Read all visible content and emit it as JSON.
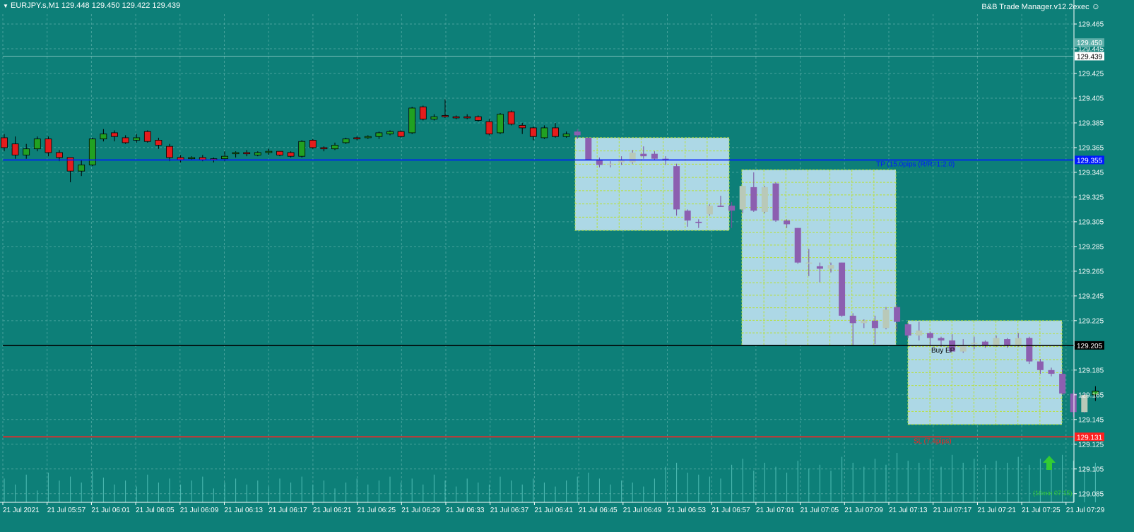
{
  "header": {
    "symbol_info": "EURJPY.s,M1  129.448 129.450 129.422 129.439",
    "ea_name": "B&B Trade Manager.v12.2exec"
  },
  "colors": {
    "background": "#0d7f78",
    "bull_candle": "#21a121",
    "bear_candle": "#e51c1c",
    "box_candle_bear": "#8c5fb0",
    "box_candle_bull": "#b9c9b8",
    "box_fill": "#add8e6",
    "box_grid": "#b8e03a",
    "tp_line": "#0019ff",
    "ep_line": "#000000",
    "sl_line": "#ff2020"
  },
  "chart_data": {
    "type": "candlestick",
    "symbol": "EURJPY.s",
    "timeframe": "M1",
    "y_axis": {
      "ylim": [
        129.078,
        129.473
      ],
      "ticks": [
        "129.465",
        "129.445",
        "129.425",
        "129.405",
        "129.385",
        "129.365",
        "129.345",
        "129.325",
        "129.305",
        "129.285",
        "129.265",
        "129.245",
        "129.225",
        "129.205",
        "129.185",
        "129.165",
        "129.145",
        "129.125",
        "129.105",
        "129.085"
      ]
    },
    "x_axis": {
      "ticks": [
        "21 Jul 2021",
        "21 Jul 05:57",
        "21 Jul 06:01",
        "21 Jul 06:05",
        "21 Jul 06:09",
        "21 Jul 06:13",
        "21 Jul 06:17",
        "21 Jul 06:21",
        "21 Jul 06:25",
        "21 Jul 06:29",
        "21 Jul 06:33",
        "21 Jul 06:37",
        "21 Jul 06:41",
        "21 Jul 06:45",
        "21 Jul 06:49",
        "21 Jul 06:53",
        "21 Jul 06:57",
        "21 Jul 07:01",
        "21 Jul 07:05",
        "21 Jul 07:09",
        "21 Jul 07:13",
        "21 Jul 07:17",
        "21 Jul 07:21",
        "21 Jul 07:25",
        "21 Jul 07:29"
      ]
    },
    "candles": [
      [
        129.373,
        129.376,
        129.362,
        129.365
      ],
      [
        129.368,
        129.374,
        129.356,
        129.359
      ],
      [
        129.359,
        129.368,
        129.356,
        129.364
      ],
      [
        129.364,
        129.374,
        129.362,
        129.372
      ],
      [
        129.372,
        129.374,
        129.358,
        129.361
      ],
      [
        129.361,
        129.363,
        129.354,
        129.357
      ],
      [
        129.357,
        129.357,
        129.337,
        129.346
      ],
      [
        129.346,
        129.355,
        129.342,
        129.351
      ],
      [
        129.351,
        129.373,
        129.35,
        129.372
      ],
      [
        129.372,
        129.38,
        129.37,
        129.376
      ],
      [
        129.377,
        129.379,
        129.37,
        129.374
      ],
      [
        129.373,
        129.375,
        129.368,
        129.369
      ],
      [
        129.371,
        129.376,
        129.369,
        129.373
      ],
      [
        129.378,
        129.379,
        129.369,
        129.37
      ],
      [
        129.371,
        129.373,
        129.364,
        129.367
      ],
      [
        129.366,
        129.368,
        129.354,
        129.357
      ],
      [
        129.357,
        129.359,
        129.353,
        129.355
      ],
      [
        129.356,
        129.358,
        129.355,
        129.357
      ],
      [
        129.357,
        129.359,
        129.354,
        129.355
      ],
      [
        129.356,
        129.357,
        129.353,
        129.355
      ],
      [
        129.356,
        129.362,
        129.354,
        129.358
      ],
      [
        129.36,
        129.362,
        129.357,
        129.361
      ],
      [
        129.361,
        129.363,
        129.358,
        129.36
      ],
      [
        129.359,
        129.362,
        129.358,
        129.361
      ],
      [
        129.361,
        129.364,
        129.359,
        129.362
      ],
      [
        129.362,
        129.362,
        129.358,
        129.359
      ],
      [
        129.361,
        129.362,
        129.357,
        129.358
      ],
      [
        129.358,
        129.371,
        129.357,
        129.37
      ],
      [
        129.371,
        129.372,
        129.364,
        129.365
      ],
      [
        129.365,
        129.366,
        129.362,
        129.364
      ],
      [
        129.364,
        129.369,
        129.363,
        129.367
      ],
      [
        129.369,
        129.373,
        129.368,
        129.372
      ],
      [
        129.373,
        129.374,
        129.371,
        129.372
      ],
      [
        129.373,
        129.375,
        129.372,
        129.374
      ],
      [
        129.374,
        129.378,
        129.372,
        129.377
      ],
      [
        129.376,
        129.379,
        129.375,
        129.378
      ],
      [
        129.378,
        129.379,
        129.373,
        129.374
      ],
      [
        129.377,
        129.398,
        129.376,
        129.397
      ],
      [
        129.398,
        129.399,
        129.387,
        129.388
      ],
      [
        129.388,
        129.392,
        129.387,
        129.39
      ],
      [
        129.391,
        129.404,
        129.389,
        129.39
      ],
      [
        129.39,
        129.391,
        129.388,
        129.389
      ],
      [
        129.39,
        129.392,
        129.388,
        129.389
      ],
      [
        129.39,
        129.391,
        129.386,
        129.387
      ],
      [
        129.386,
        129.388,
        129.375,
        129.376
      ],
      [
        129.377,
        129.393,
        129.376,
        129.392
      ],
      [
        129.394,
        129.395,
        129.383,
        129.384
      ],
      [
        129.383,
        129.385,
        129.376,
        129.381
      ],
      [
        129.381,
        129.382,
        129.371,
        129.374
      ],
      [
        129.373,
        129.383,
        129.372,
        129.381
      ],
      [
        129.381,
        129.385,
        129.373,
        129.374
      ],
      [
        129.374,
        129.378,
        129.373,
        129.376
      ],
      [
        129.378,
        129.38,
        129.372,
        129.375
      ],
      [
        129.373,
        129.373,
        129.355,
        129.355
      ],
      [
        129.355,
        129.357,
        129.349,
        129.351
      ],
      [
        129.351,
        129.354,
        129.349,
        129.352
      ],
      [
        129.353,
        129.358,
        129.351,
        129.355
      ],
      [
        129.353,
        129.363,
        129.352,
        129.361
      ],
      [
        129.36,
        129.366,
        129.356,
        129.358
      ],
      [
        129.36,
        129.362,
        129.355,
        129.356
      ],
      [
        129.356,
        129.358,
        129.351,
        129.355
      ],
      [
        129.35,
        129.352,
        129.31,
        129.315
      ],
      [
        129.314,
        129.315,
        129.301,
        129.306
      ],
      [
        129.305,
        129.307,
        129.3,
        129.304
      ],
      [
        129.311,
        129.319,
        129.31,
        129.318
      ],
      [
        129.318,
        129.326,
        129.317,
        129.317
      ],
      [
        129.318,
        129.321,
        129.3,
        129.314
      ],
      [
        129.315,
        129.334,
        129.312,
        129.334
      ],
      [
        129.333,
        129.345,
        129.313,
        129.314
      ],
      [
        129.313,
        129.334,
        129.312,
        129.333
      ],
      [
        129.336,
        129.337,
        129.305,
        129.306
      ],
      [
        129.306,
        129.307,
        129.3,
        129.303
      ],
      [
        129.3,
        129.3,
        129.271,
        129.272
      ],
      [
        129.272,
        129.283,
        129.261,
        129.272
      ],
      [
        129.269,
        129.272,
        129.256,
        129.267
      ],
      [
        129.267,
        129.272,
        129.264,
        129.27
      ],
      [
        129.272,
        129.272,
        129.228,
        129.229
      ],
      [
        129.229,
        129.231,
        129.205,
        129.223
      ],
      [
        129.223,
        129.226,
        129.219,
        129.225
      ],
      [
        129.225,
        129.229,
        129.206,
        129.219
      ],
      [
        129.219,
        129.236,
        129.218,
        129.234
      ],
      [
        129.236,
        129.238,
        129.216,
        129.224
      ],
      [
        129.222,
        129.223,
        129.211,
        129.213
      ],
      [
        129.213,
        129.224,
        129.209,
        129.217
      ],
      [
        129.215,
        129.216,
        129.205,
        129.211
      ],
      [
        129.211,
        129.212,
        129.204,
        129.209
      ],
      [
        129.209,
        129.214,
        129.202,
        129.2
      ],
      [
        129.2,
        129.21,
        129.199,
        129.205
      ],
      [
        129.206,
        129.212,
        129.202,
        129.207
      ],
      [
        129.208,
        129.209,
        129.203,
        129.205
      ],
      [
        129.205,
        129.213,
        129.204,
        129.211
      ],
      [
        129.21,
        129.211,
        129.203,
        129.205
      ],
      [
        129.205,
        129.215,
        129.204,
        129.211
      ],
      [
        129.211,
        129.212,
        129.19,
        129.192
      ],
      [
        129.192,
        129.194,
        129.182,
        129.185
      ],
      [
        129.185,
        129.187,
        129.18,
        129.182
      ],
      [
        129.182,
        129.186,
        129.165,
        129.166
      ],
      [
        129.166,
        129.169,
        129.147,
        129.151
      ],
      [
        129.151,
        129.166,
        129.15,
        129.165
      ],
      [
        129.165,
        129.172,
        129.16,
        129.168
      ]
    ],
    "box_candles_from": 52,
    "volumes": [
      24,
      18,
      28,
      12,
      30,
      22,
      26,
      20,
      32,
      25,
      18,
      22,
      16,
      28,
      20,
      24,
      18,
      22,
      26,
      14,
      20,
      24,
      18,
      22,
      16,
      24,
      20,
      26,
      18,
      22,
      14,
      20,
      24,
      18,
      22,
      26,
      20,
      24,
      18,
      28,
      22,
      16,
      24,
      20,
      18,
      26,
      22,
      18,
      24,
      20,
      16,
      22,
      26,
      30,
      24,
      18,
      22,
      20,
      16,
      24,
      36,
      40,
      30,
      28,
      26,
      24,
      38,
      44,
      32,
      40,
      36,
      30,
      42,
      34,
      38,
      32,
      46,
      40,
      36,
      44,
      38,
      50,
      42,
      40,
      44,
      36,
      48,
      40,
      44,
      38,
      42,
      40,
      46,
      38,
      44,
      40,
      48,
      42,
      36,
      40
    ],
    "boxes": [
      {
        "x_from": 814,
        "x_to": 1032,
        "y_top": 129.373,
        "y_bottom": 129.298
      },
      {
        "x_from": 1050,
        "x_to": 1268,
        "y_top": 129.347,
        "y_bottom": 129.205
      },
      {
        "x_from": 1285,
        "x_to": 1503,
        "y_top": 129.225,
        "y_bottom": 129.141
      }
    ],
    "levels": [
      {
        "name": "tp",
        "price": 129.355,
        "axis_label": "129.355",
        "text": "TP (15.0pips (R/R=1:2.0)"
      },
      {
        "name": "ep",
        "price": 129.205,
        "axis_label": "129.205",
        "text": "Buy EP"
      },
      {
        "name": "sl",
        "price": 129.131,
        "axis_label": "129.131",
        "text": "SL (7.4pips)"
      }
    ],
    "current": {
      "price": 129.439,
      "axis_label": "129.439"
    },
    "ask": {
      "price": 129.45,
      "axis_label": "129.450"
    },
    "timer_text": "(16min 07:15)"
  }
}
